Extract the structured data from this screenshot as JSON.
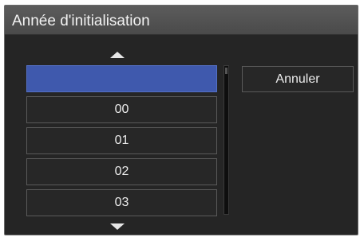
{
  "dialog": {
    "title": "Année d'initialisation"
  },
  "list": {
    "items": [
      {
        "label": "",
        "selected": true
      },
      {
        "label": "00",
        "selected": false
      },
      {
        "label": "01",
        "selected": false
      },
      {
        "label": "02",
        "selected": false
      },
      {
        "label": "03",
        "selected": false
      }
    ],
    "scroll_up_icon": "triangle-up-icon",
    "scroll_down_icon": "triangle-down-icon"
  },
  "actions": {
    "cancel_label": "Annuler"
  },
  "colors": {
    "selection": "#3f59ad",
    "background": "#252525",
    "title_bar": "#555555",
    "text": "#ececec"
  }
}
